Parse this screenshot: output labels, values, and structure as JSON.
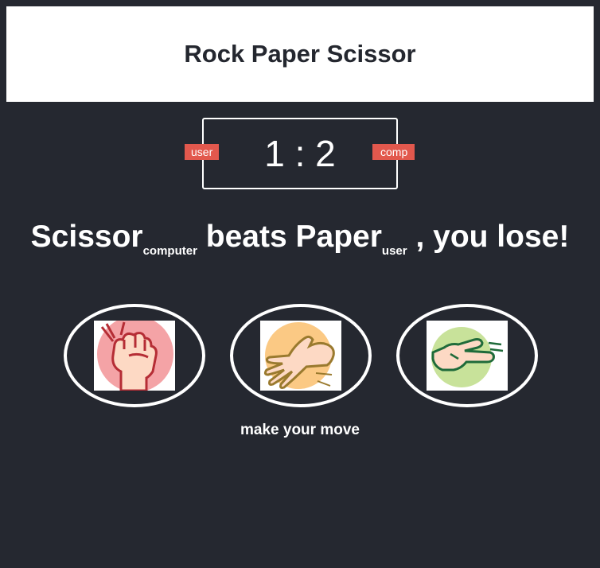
{
  "app": {
    "title": "Rock Paper Scissor"
  },
  "scoreboard": {
    "user_label": "user",
    "comp_label": "comp",
    "user_score": "1",
    "separator": ":",
    "comp_score": "2"
  },
  "result": {
    "winner_move": "Scissor",
    "winner_tag": "computer",
    "verb": "beats",
    "loser_move": "Paper",
    "loser_tag": "user",
    "outcome": ", you lose!"
  },
  "choices": [
    {
      "name": "rock",
      "icon": "rock-fist-icon",
      "color": "#f4a3a6"
    },
    {
      "name": "paper",
      "icon": "paper-hand-icon",
      "color": "#fbc984"
    },
    {
      "name": "scissor",
      "icon": "scissor-hand-icon",
      "color": "#c8e29a"
    }
  ],
  "hint": "make your move",
  "colors": {
    "background": "#252830",
    "badge": "#e2584d",
    "header_bg": "#ffffff"
  }
}
